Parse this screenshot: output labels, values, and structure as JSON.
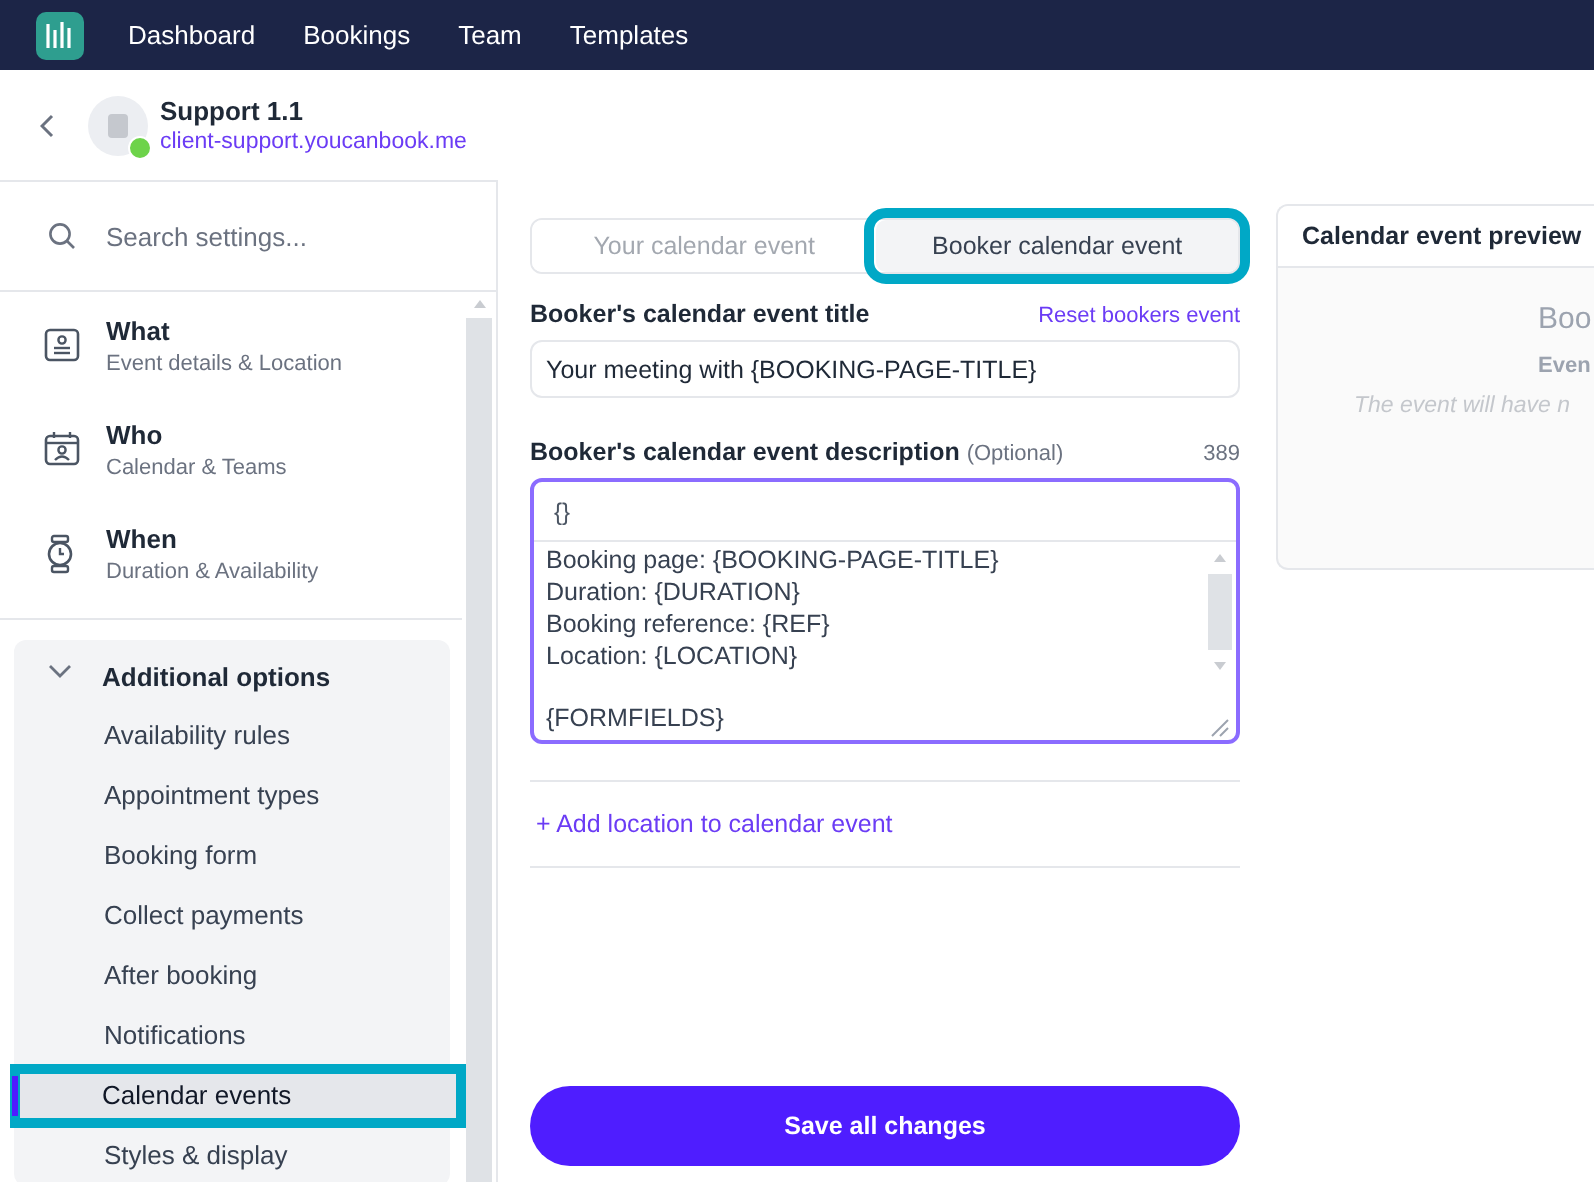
{
  "nav": {
    "items": [
      "Dashboard",
      "Bookings",
      "Team",
      "Templates"
    ]
  },
  "header": {
    "title": "Support 1.1",
    "url": "client-support.youcanbook.me",
    "online": true
  },
  "sidebar": {
    "search": {
      "placeholder": "Search settings..."
    },
    "sections": [
      {
        "kind": "what",
        "title": "What",
        "subtitle": "Event details & Location"
      },
      {
        "kind": "who",
        "title": "Who",
        "subtitle": "Calendar & Teams"
      },
      {
        "kind": "when",
        "title": "When",
        "subtitle": "Duration & Availability"
      }
    ],
    "group": {
      "title": "Additional options",
      "expanded": true,
      "items": [
        {
          "label": "Availability rules",
          "selected": false,
          "highlighted": false
        },
        {
          "label": "Appointment types",
          "selected": false,
          "highlighted": false
        },
        {
          "label": "Booking form",
          "selected": false,
          "highlighted": false
        },
        {
          "label": "Collect payments",
          "selected": false,
          "highlighted": false
        },
        {
          "label": "After booking",
          "selected": false,
          "highlighted": false
        },
        {
          "label": "Notifications",
          "selected": false,
          "highlighted": false
        },
        {
          "label": "Calendar events",
          "selected": true,
          "highlighted": true
        },
        {
          "label": "Styles & display",
          "selected": false,
          "highlighted": false
        }
      ]
    }
  },
  "editor": {
    "tabs": [
      {
        "label": "Your calendar event",
        "selected": false,
        "highlighted": false
      },
      {
        "label": "Booker calendar event",
        "selected": true,
        "highlighted": true
      }
    ],
    "title_field": {
      "label": "Booker's calendar event title",
      "reset_link": "Reset bookers event",
      "value": "Your meeting with {BOOKING-PAGE-TITLE}"
    },
    "description_field": {
      "label": "Booker's calendar event description",
      "optional": "(Optional)",
      "count": "389",
      "toolbar_button": "{}",
      "focused": true,
      "paragraphs": [
        [
          "Booking page: {BOOKING-PAGE-TITLE}",
          "Duration: {DURATION}",
          "Booking reference: {REF}",
          "Location: {LOCATION}"
        ],
        [
          "{FORMFIELDS}"
        ]
      ]
    },
    "add_location": "+ Add location to calendar event",
    "save_button": "Save all changes"
  },
  "preview": {
    "title": "Calendar event preview",
    "heading": "Boo",
    "subheading": "Even",
    "note": "The event will have n"
  }
}
